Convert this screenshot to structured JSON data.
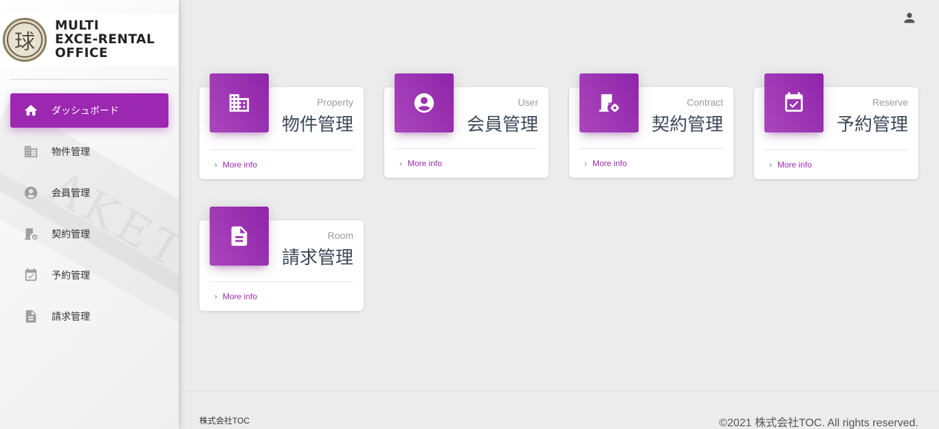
{
  "brand": {
    "line1": "MULTI",
    "line2": "EXCE-RENTAL",
    "line3": "OFFICE",
    "mark_glyph": "球"
  },
  "sidebar": {
    "items": [
      {
        "label": "ダッシュボード",
        "icon": "home-icon",
        "active": true
      },
      {
        "label": "物件管理",
        "icon": "building-icon",
        "active": false
      },
      {
        "label": "会員管理",
        "icon": "account-circle-icon",
        "active": false
      },
      {
        "label": "契約管理",
        "icon": "door-gear-icon",
        "active": false
      },
      {
        "label": "予約管理",
        "icon": "event-available-icon",
        "active": false
      },
      {
        "label": "請求管理",
        "icon": "description-icon",
        "active": false
      }
    ]
  },
  "header": {
    "user_icon": "person-icon"
  },
  "cards": [
    {
      "category": "Property",
      "title": "物件管理",
      "link": "More info",
      "icon": "building-icon"
    },
    {
      "category": "User",
      "title": "会員管理",
      "link": "More info",
      "icon": "account-circle-icon"
    },
    {
      "category": "Contract",
      "title": "契約管理",
      "link": "More info",
      "icon": "door-gear-icon"
    },
    {
      "category": "Reserve",
      "title": "予約管理",
      "link": "More info",
      "icon": "event-available-icon"
    },
    {
      "category": "Room",
      "title": "請求管理",
      "link": "More info",
      "icon": "description-icon"
    }
  ],
  "footer": {
    "company": "株式会社TOC",
    "copyright": "©2021 株式会社TOC. All rights reserved."
  },
  "colors": {
    "accent": "#9c27b0",
    "background": "#ececec"
  }
}
